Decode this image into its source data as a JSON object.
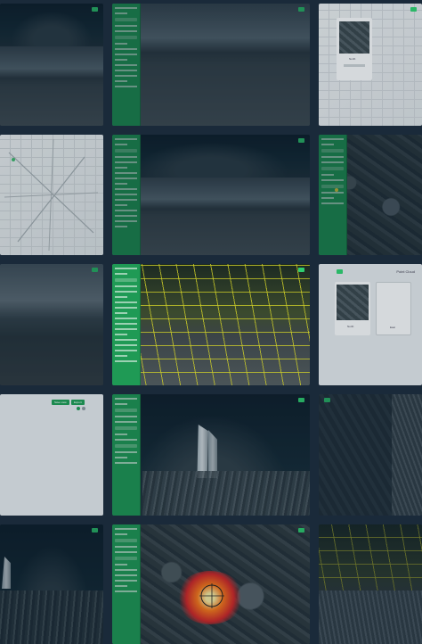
{
  "app": {
    "accent_color": "#1f9a55",
    "background_color": "#1a2a3a"
  },
  "tiles": [
    {
      "scene": "street-panorama"
    },
    {
      "scene": "street-with-sidebar"
    },
    {
      "scene": "map-modal"
    },
    {
      "scene": "map-view"
    },
    {
      "scene": "street-with-sidebar"
    },
    {
      "scene": "aerial-with-sidebar"
    },
    {
      "scene": "street-panorama"
    },
    {
      "scene": "pointcloud-grid-with-sidebar"
    },
    {
      "scene": "compare-dialog"
    },
    {
      "scene": "blank-form"
    },
    {
      "scene": "tower-pointcloud-with-sidebar"
    },
    {
      "scene": "waterfront-aerial"
    },
    {
      "scene": "night-pointcloud"
    },
    {
      "scene": "heatmap-pointcloud-with-sidebar"
    },
    {
      "scene": "waterfront-grid"
    }
  ],
  "dialogs": {
    "compare_title": "Point Cloud",
    "left_caption": "North",
    "right_caption": "East",
    "modal_caption": "North"
  },
  "buttons": {
    "primary": "Save view",
    "secondary": "Export"
  }
}
